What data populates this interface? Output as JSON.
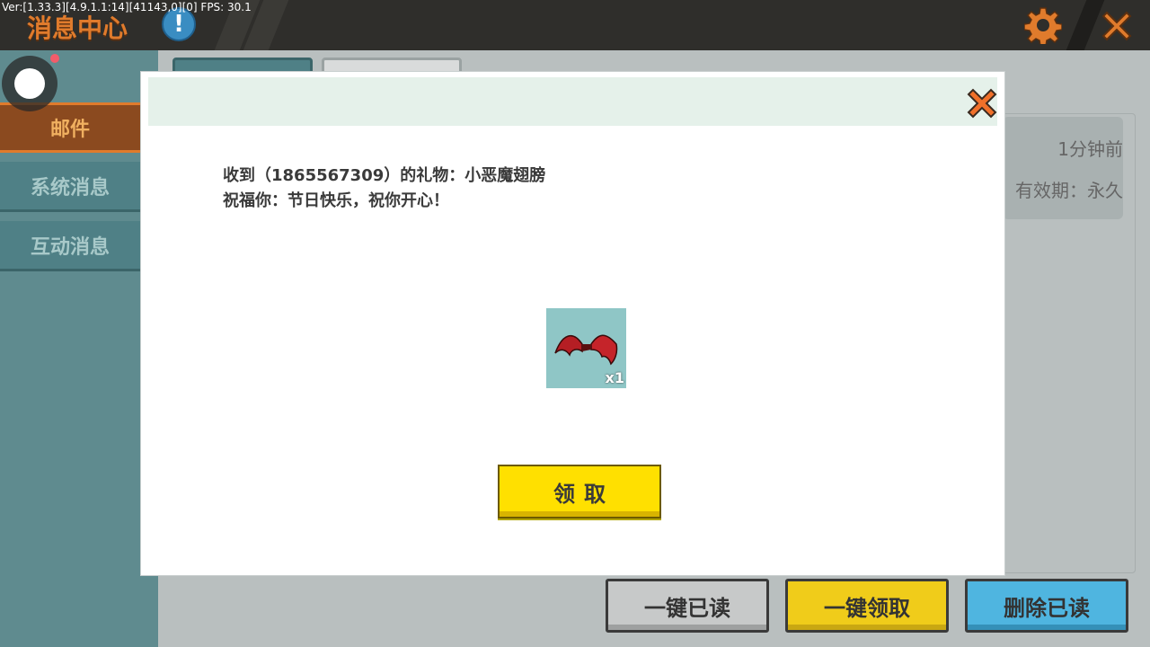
{
  "debug": {
    "version_text": "Ver:[1.33.3][4.9.1.1:14][41143,0][0] FPS: 30.1"
  },
  "header": {
    "title": "消息中心",
    "help_symbol": "!"
  },
  "sidebar": {
    "items": [
      {
        "label": "邮件"
      },
      {
        "label": "系统消息"
      },
      {
        "label": "互动消息"
      }
    ]
  },
  "mail_preview": {
    "time": "1分钟前",
    "expiry": "有效期：永久"
  },
  "bottom_buttons": {
    "mark_all_read": "一键已读",
    "claim_all": "一键领取",
    "delete_read": "删除已读"
  },
  "modal": {
    "message_line1": "收到（1865567309）的礼物：小恶魔翅膀",
    "message_line2": "祝福你：节日快乐，祝你开心！",
    "item_count": "x1",
    "claim_label": "领取"
  },
  "colors": {
    "accent_orange": "#e07b2c",
    "claim_yellow": "#ffe000",
    "header_bg": "#e5f1ea"
  }
}
